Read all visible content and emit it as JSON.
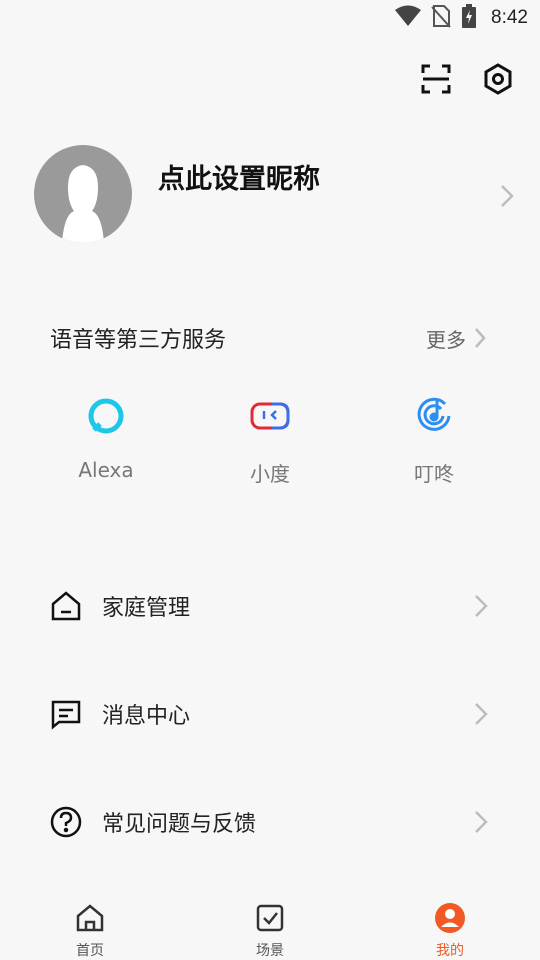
{
  "status_bar": {
    "time": "8:42",
    "icons": [
      "wifi-icon",
      "no-sim-icon",
      "battery-charging-icon"
    ]
  },
  "top_actions": {
    "icons": [
      "scan-icon",
      "settings-icon"
    ]
  },
  "profile": {
    "nickname": "点此设置昵称",
    "avatar_icon": "default-avatar-icon"
  },
  "voice_services": {
    "title": "语音等第三方服务",
    "more_label": "更多",
    "items": [
      {
        "label": "Alexa",
        "icon": "alexa-icon",
        "color": "#1cc7e8"
      },
      {
        "label": "小度",
        "icon": "xiaodu-icon",
        "color": "#e02b39"
      },
      {
        "label": "叮咚",
        "icon": "dingdong-icon",
        "color": "#2b8ff2"
      }
    ]
  },
  "menu": [
    {
      "label": "家庭管理",
      "icon": "home-icon"
    },
    {
      "label": "消息中心",
      "icon": "message-icon"
    },
    {
      "label": "常见问题与反馈",
      "icon": "help-icon"
    }
  ],
  "tabbar": [
    {
      "label": "首页",
      "icon": "home-tab-icon",
      "active": false
    },
    {
      "label": "场景",
      "icon": "scene-tab-icon",
      "active": false
    },
    {
      "label": "我的",
      "icon": "profile-tab-icon",
      "active": true
    }
  ],
  "colors": {
    "accent": "#f15a24",
    "background": "#f7f7f7",
    "chevron": "#bcbcbc"
  }
}
